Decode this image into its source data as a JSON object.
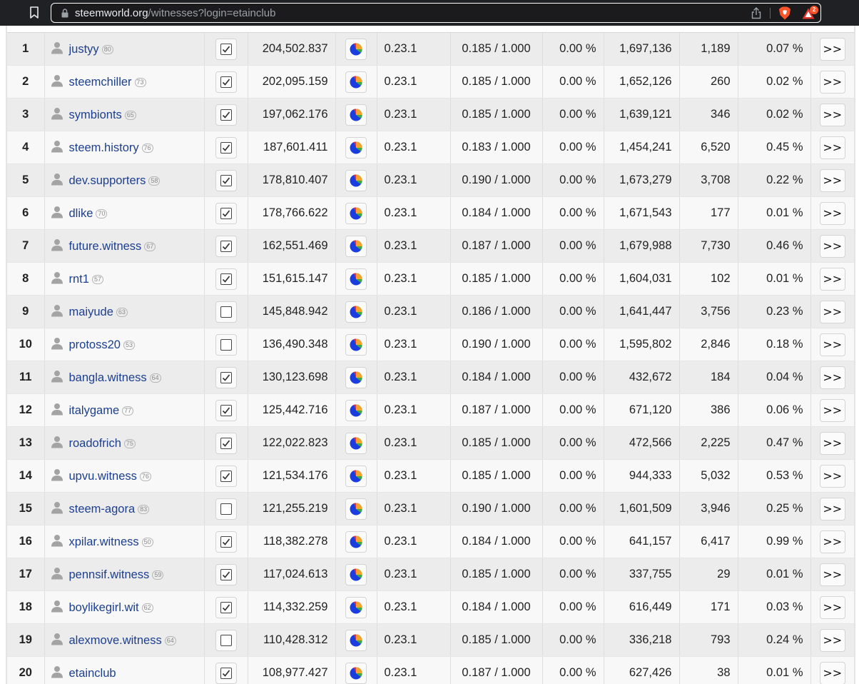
{
  "browser": {
    "url_host": "steemworld.org",
    "url_path": "/witnesses?login=etainclub",
    "rewards_badge": "2"
  },
  "colors": {
    "link": "#1d3f8f",
    "row_odd": "#ececec",
    "row_even": "#f8f8f8"
  },
  "pie_colors": [
    "#1a3de0",
    "#f2a527",
    "#38a844",
    "#e2362c"
  ],
  "witnesses": [
    {
      "rank": "1",
      "name": "justyy",
      "rep": "80",
      "voted": true,
      "votes": "204,502.837",
      "version": "0.23.1",
      "price": "0.185 / 1.000",
      "apr": "0.00 %",
      "last_block": "1,697,136",
      "missed": "1,189",
      "missed_pct": "0.07 %",
      "more": ">>"
    },
    {
      "rank": "2",
      "name": "steemchiller",
      "rep": "73",
      "voted": true,
      "votes": "202,095.159",
      "version": "0.23.1",
      "price": "0.185 / 1.000",
      "apr": "0.00 %",
      "last_block": "1,652,126",
      "missed": "260",
      "missed_pct": "0.02 %",
      "more": ">>"
    },
    {
      "rank": "3",
      "name": "symbionts",
      "rep": "65",
      "voted": true,
      "votes": "197,062.176",
      "version": "0.23.1",
      "price": "0.185 / 1.000",
      "apr": "0.00 %",
      "last_block": "1,639,121",
      "missed": "346",
      "missed_pct": "0.02 %",
      "more": ">>"
    },
    {
      "rank": "4",
      "name": "steem.history",
      "rep": "76",
      "voted": true,
      "votes": "187,601.411",
      "version": "0.23.1",
      "price": "0.183 / 1.000",
      "apr": "0.00 %",
      "last_block": "1,454,241",
      "missed": "6,520",
      "missed_pct": "0.45 %",
      "more": ">>"
    },
    {
      "rank": "5",
      "name": "dev.supporters",
      "rep": "58",
      "voted": true,
      "votes": "178,810.407",
      "version": "0.23.1",
      "price": "0.190 / 1.000",
      "apr": "0.00 %",
      "last_block": "1,673,279",
      "missed": "3,708",
      "missed_pct": "0.22 %",
      "more": ">>"
    },
    {
      "rank": "6",
      "name": "dlike",
      "rep": "70",
      "voted": true,
      "votes": "178,766.622",
      "version": "0.23.1",
      "price": "0.184 / 1.000",
      "apr": "0.00 %",
      "last_block": "1,671,543",
      "missed": "177",
      "missed_pct": "0.01 %",
      "more": ">>"
    },
    {
      "rank": "7",
      "name": "future.witness",
      "rep": "67",
      "voted": true,
      "votes": "162,551.469",
      "version": "0.23.1",
      "price": "0.187 / 1.000",
      "apr": "0.00 %",
      "last_block": "1,679,988",
      "missed": "7,730",
      "missed_pct": "0.46 %",
      "more": ">>"
    },
    {
      "rank": "8",
      "name": "rnt1",
      "rep": "57",
      "voted": true,
      "votes": "151,615.147",
      "version": "0.23.1",
      "price": "0.185 / 1.000",
      "apr": "0.00 %",
      "last_block": "1,604,031",
      "missed": "102",
      "missed_pct": "0.01 %",
      "more": ">>"
    },
    {
      "rank": "9",
      "name": "maiyude",
      "rep": "63",
      "voted": false,
      "votes": "145,848.942",
      "version": "0.23.1",
      "price": "0.186 / 1.000",
      "apr": "0.00 %",
      "last_block": "1,641,447",
      "missed": "3,756",
      "missed_pct": "0.23 %",
      "more": ">>"
    },
    {
      "rank": "10",
      "name": "protoss20",
      "rep": "53",
      "voted": false,
      "votes": "136,490.348",
      "version": "0.23.1",
      "price": "0.190 / 1.000",
      "apr": "0.00 %",
      "last_block": "1,595,802",
      "missed": "2,846",
      "missed_pct": "0.18 %",
      "more": ">>"
    },
    {
      "rank": "11",
      "name": "bangla.witness",
      "rep": "64",
      "voted": true,
      "votes": "130,123.698",
      "version": "0.23.1",
      "price": "0.184 / 1.000",
      "apr": "0.00 %",
      "last_block": "432,672",
      "missed": "184",
      "missed_pct": "0.04 %",
      "more": ">>"
    },
    {
      "rank": "12",
      "name": "italygame",
      "rep": "77",
      "voted": true,
      "votes": "125,442.716",
      "version": "0.23.1",
      "price": "0.187 / 1.000",
      "apr": "0.00 %",
      "last_block": "671,120",
      "missed": "386",
      "missed_pct": "0.06 %",
      "more": ">>"
    },
    {
      "rank": "13",
      "name": "roadofrich",
      "rep": "75",
      "voted": true,
      "votes": "122,022.823",
      "version": "0.23.1",
      "price": "0.185 / 1.000",
      "apr": "0.00 %",
      "last_block": "472,566",
      "missed": "2,225",
      "missed_pct": "0.47 %",
      "more": ">>"
    },
    {
      "rank": "14",
      "name": "upvu.witness",
      "rep": "76",
      "voted": true,
      "votes": "121,534.176",
      "version": "0.23.1",
      "price": "0.185 / 1.000",
      "apr": "0.00 %",
      "last_block": "944,333",
      "missed": "5,032",
      "missed_pct": "0.53 %",
      "more": ">>"
    },
    {
      "rank": "15",
      "name": "steem-agora",
      "rep": "83",
      "voted": false,
      "votes": "121,255.219",
      "version": "0.23.1",
      "price": "0.190 / 1.000",
      "apr": "0.00 %",
      "last_block": "1,601,509",
      "missed": "3,946",
      "missed_pct": "0.25 %",
      "more": ">>"
    },
    {
      "rank": "16",
      "name": "xpilar.witness",
      "rep": "50",
      "voted": true,
      "votes": "118,382.278",
      "version": "0.23.1",
      "price": "0.184 / 1.000",
      "apr": "0.00 %",
      "last_block": "641,157",
      "missed": "6,417",
      "missed_pct": "0.99 %",
      "more": ">>"
    },
    {
      "rank": "17",
      "name": "pennsif.witness",
      "rep": "59",
      "voted": true,
      "votes": "117,024.613",
      "version": "0.23.1",
      "price": "0.185 / 1.000",
      "apr": "0.00 %",
      "last_block": "337,755",
      "missed": "29",
      "missed_pct": "0.01 %",
      "more": ">>"
    },
    {
      "rank": "18",
      "name": "boylikegirl.wit",
      "rep": "62",
      "voted": true,
      "votes": "114,332.259",
      "version": "0.23.1",
      "price": "0.184 / 1.000",
      "apr": "0.00 %",
      "last_block": "616,449",
      "missed": "171",
      "missed_pct": "0.03 %",
      "more": ">>"
    },
    {
      "rank": "19",
      "name": "alexmove.witness",
      "rep": "64",
      "voted": false,
      "votes": "110,428.312",
      "version": "0.23.1",
      "price": "0.185 / 1.000",
      "apr": "0.00 %",
      "last_block": "336,218",
      "missed": "793",
      "missed_pct": "0.24 %",
      "more": ">>"
    },
    {
      "rank": "20",
      "name": "etainclub",
      "rep": "",
      "voted": true,
      "votes": "108,977.427",
      "version": "0.23.1",
      "price": "0.187 / 1.000",
      "apr": "0.00 %",
      "last_block": "627,426",
      "missed": "38",
      "missed_pct": "0.01 %",
      "more": ">>"
    }
  ]
}
